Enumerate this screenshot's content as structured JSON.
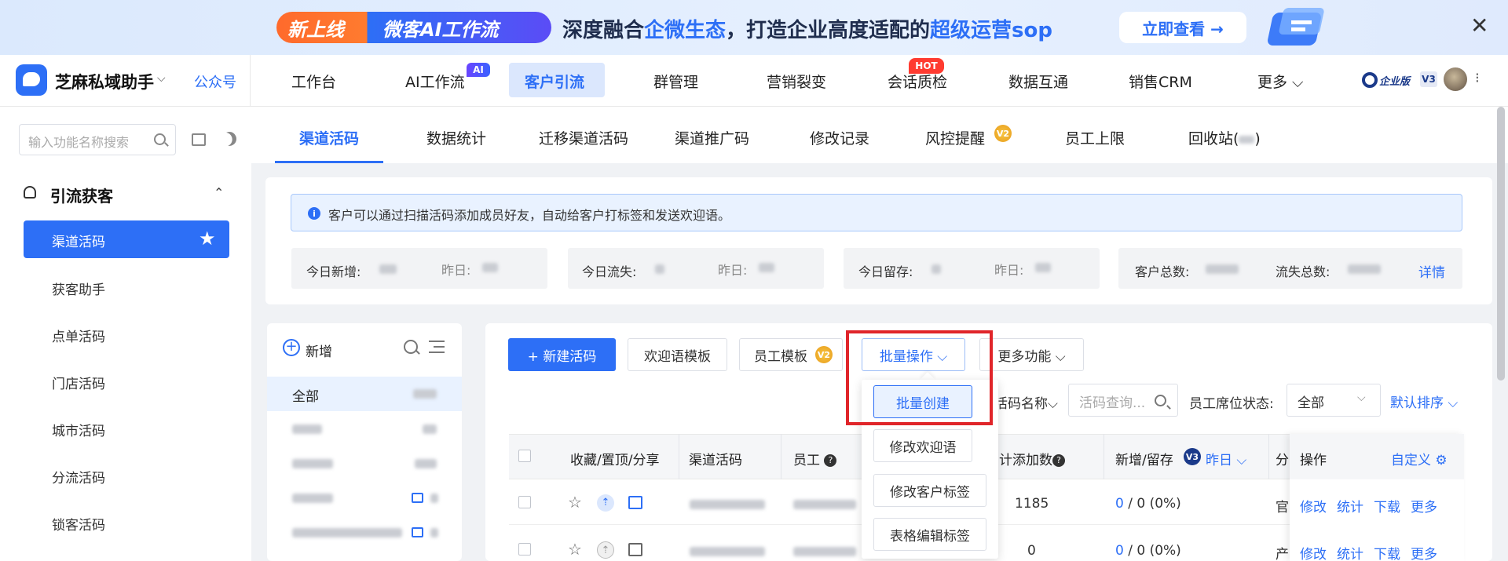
{
  "banner": {
    "pill_left": "新上线",
    "pill_right": "微客AI工作流",
    "text_a": "深度融合",
    "text_hl1": "企微生态",
    "text_b": "，打造企业高度适配的",
    "text_hl2": "超级运营sop",
    "cta": "立即查看 →",
    "close": "✕"
  },
  "app": {
    "name": "芝麻私域助手",
    "caret": "⌵",
    "gzh": "公众号"
  },
  "nav": {
    "items": [
      "工作台",
      "AI工作流",
      "客户引流",
      "群管理",
      "营销裂变",
      "会话质检",
      "数据互通",
      "销售CRM",
      "更多 ⌵"
    ],
    "active_index": 2,
    "badge_ai": "AI",
    "badge_hot": "HOT",
    "edition": "企业版",
    "version": "V3",
    "more": "⁝"
  },
  "sidebar": {
    "search_placeholder": "输入功能名称搜索",
    "group_title": "引流获客",
    "group_caret": "⌃",
    "items": [
      "渠道活码",
      "获客助手",
      "点单活码",
      "门店活码",
      "城市活码",
      "分流活码",
      "锁客活码"
    ],
    "active_index": 0
  },
  "tabs": {
    "items": [
      "渠道活码",
      "数据统计",
      "迁移渠道活码",
      "渠道推广码",
      "修改记录",
      "风控提醒",
      "员工上限",
      "回收站("
    ],
    "close_paren": ")",
    "v2": "V2"
  },
  "info": {
    "icon": "i",
    "text": "客户可以通过扫描活码添加成员好友，自动给客户打标签和发送欢迎语。"
  },
  "stats": {
    "today_new": "今日新增:",
    "today_lost": "今日流失:",
    "today_keep": "今日留存:",
    "yesterday": "昨日:",
    "total_customers": "客户总数:",
    "total_lost": "流失总数:",
    "detail": "详情"
  },
  "left_panel": {
    "add_label": "新增",
    "all_label": "全部"
  },
  "toolbar": {
    "new_code": "+ 新建活码",
    "welcome_template": "欢迎语模板",
    "staff_template": "员工模板",
    "batch_ops": "批量操作 ⌵",
    "more_functions": "更多功能 ⌵"
  },
  "dropdown": [
    "批量创建",
    "修改欢迎语",
    "修改客户标签",
    "表格编辑标签"
  ],
  "filters": {
    "code_name": "活码名称⌵",
    "query_placeholder": "活码查询...",
    "seat_status_label": "员工席位状态:",
    "seat_status_value": "全部",
    "sort": "默认排序 ⌵"
  },
  "table": {
    "headers": {
      "fav": "收藏/置顶/分享",
      "code": "渠道活码",
      "staff": "员工",
      "added": "累计添加数",
      "new_keep": "新增/留存",
      "yesterday": "昨日 ⌵",
      "split": "分",
      "ops": "操作",
      "customize": "自定义 ⚙"
    },
    "rows": [
      {
        "added": "1185",
        "nk_a": "0",
        "nk_b": " / 0 (0%)",
        "split": "官"
      },
      {
        "added": "0",
        "nk_a": "0",
        "nk_b": " / 0 (0%)",
        "split": "产"
      }
    ],
    "ops": [
      "修改",
      "统计",
      "下载",
      "更多"
    ]
  },
  "colors": {
    "primary": "#2d6ff6",
    "highlight_box": "#e0252a"
  }
}
